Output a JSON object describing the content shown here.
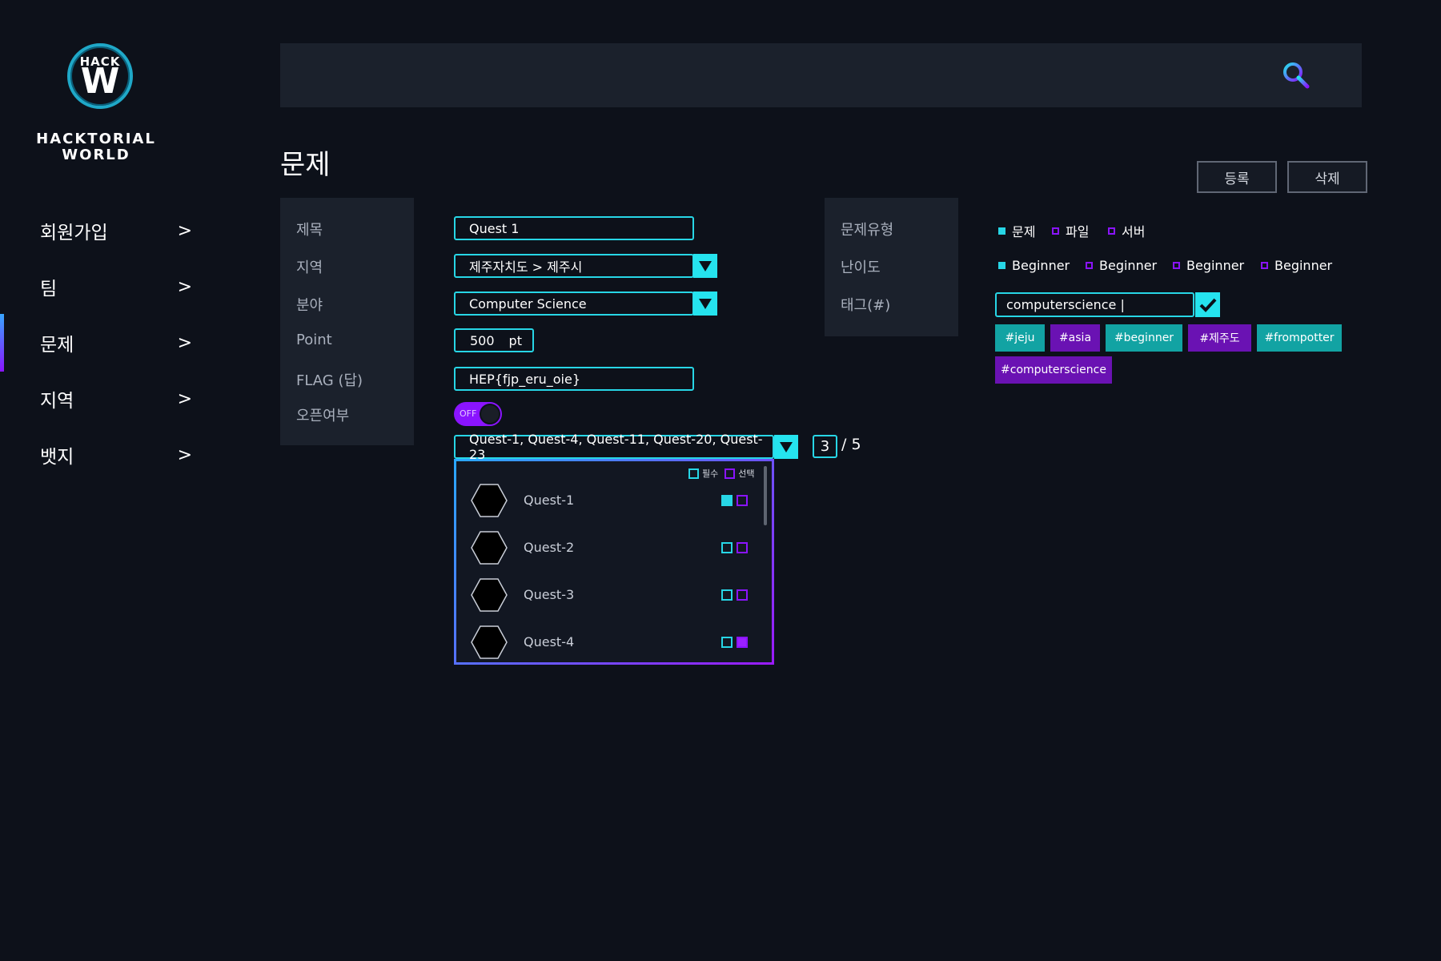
{
  "brand": {
    "badge_top": "HACK",
    "badge_letter": "W",
    "name_line1": "HACKTORIAL",
    "name_line2": "WORLD"
  },
  "sidebar": {
    "items": [
      {
        "label": "회원가입",
        "arrow": ">"
      },
      {
        "label": "팀",
        "arrow": ">"
      },
      {
        "label": "문제",
        "arrow": ">",
        "active": true
      },
      {
        "label": "지역",
        "arrow": ">"
      },
      {
        "label": "뱃지",
        "arrow": ">"
      }
    ]
  },
  "search": {
    "icon": "search-icon"
  },
  "page": {
    "title": "문제",
    "register_label": "등록",
    "delete_label": "삭제"
  },
  "form": {
    "labels": {
      "title": "제목",
      "region": "지역",
      "field": "분야",
      "point": "Point",
      "flag": "FLAG (답)",
      "open": "오픈여부"
    },
    "title_value": "Quest 1",
    "region_value": "제주자치도 > 제주시",
    "field_value": "Computer Science",
    "point_value": "500",
    "point_unit": "pt",
    "flag_value": "HEP{fjp_eru_oie}",
    "open_toggle": {
      "text": "OFF",
      "state": "off"
    },
    "prereq_value": "Quest-1, Quest-4, Quest-11, Quest-20, Quest-23",
    "prereq_count": "3",
    "prereq_total": "/ 5"
  },
  "quest_list": {
    "legend_required": "필수",
    "legend_optional": "선택",
    "rows": [
      {
        "name": "Quest-1",
        "required": true,
        "optional": false
      },
      {
        "name": "Quest-2",
        "required": false,
        "optional": false
      },
      {
        "name": "Quest-3",
        "required": false,
        "optional": false
      },
      {
        "name": "Quest-4",
        "required": false,
        "optional": true
      }
    ]
  },
  "meta_panel": {
    "labels": {
      "type": "문제유형",
      "difficulty": "난이도",
      "tags": "태그(#)"
    },
    "type_options": [
      {
        "label": "문제",
        "selected": true
      },
      {
        "label": "파일",
        "selected": false
      },
      {
        "label": "서버",
        "selected": false
      }
    ],
    "difficulty_options": [
      {
        "label": "Beginner",
        "selected": true
      },
      {
        "label": "Beginner",
        "selected": false
      },
      {
        "label": "Beginner",
        "selected": false
      },
      {
        "label": "Beginner",
        "selected": false
      }
    ],
    "tag_input_value": "computerscience |",
    "tags": [
      {
        "label": "#jeju",
        "color": "teal"
      },
      {
        "label": "#asia",
        "color": "purple"
      },
      {
        "label": "#beginner",
        "color": "teal"
      },
      {
        "label": "#제주도",
        "color": "purple"
      },
      {
        "label": "#frompotter",
        "color": "teal"
      },
      {
        "label": "#computerscience",
        "color": "purple"
      }
    ]
  },
  "colors": {
    "accent_cyan": "#27d6e6",
    "accent_purple": "#8a14ff",
    "background": "#0d111a",
    "panel": "#1b212c"
  }
}
